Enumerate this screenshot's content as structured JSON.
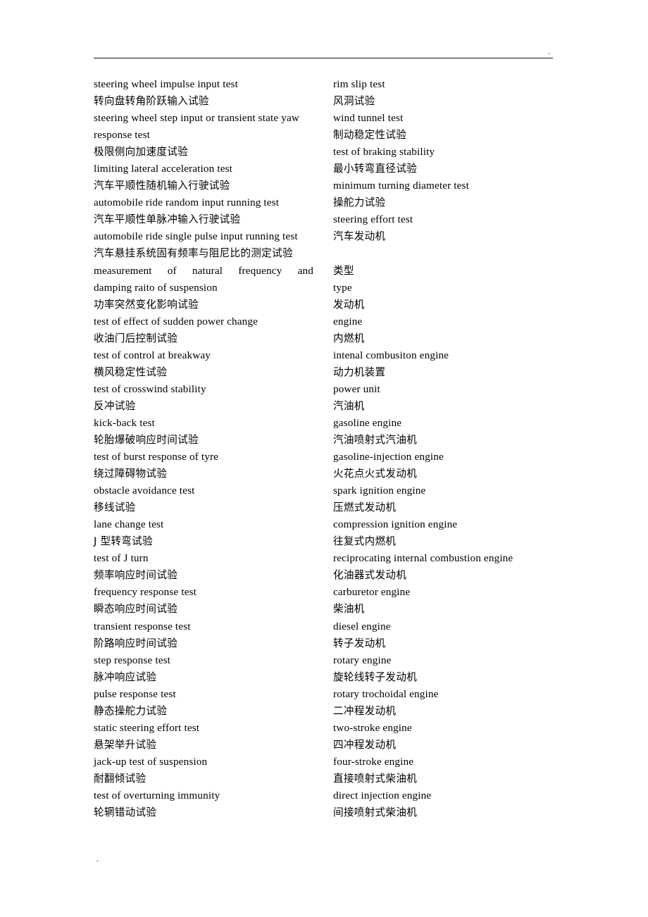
{
  "document": {
    "header_mark": ".",
    "footer_mark": ".",
    "rule": true
  },
  "glossary": {
    "left_column": [
      {
        "lang": "en",
        "text": "steering wheel impulse input test"
      },
      {
        "lang": "zh",
        "text": "转向盘转角阶跃输入试验"
      },
      {
        "lang": "en",
        "text": "steering wheel step input or transient state yaw"
      },
      {
        "lang": "en",
        "text": "response test"
      },
      {
        "lang": "zh",
        "text": "极限侧向加速度试验"
      },
      {
        "lang": "en",
        "text": "limiting lateral acceleration test"
      },
      {
        "lang": "zh",
        "text": "汽车平顺性随机输入行驶试验"
      },
      {
        "lang": "en",
        "text": "automobile ride random input running test"
      },
      {
        "lang": "zh",
        "text": "汽车平顺性单脉冲输入行驶试验"
      },
      {
        "lang": "en",
        "text": "automobile ride single pulse input running test"
      },
      {
        "lang": "zh",
        "text": "汽车悬挂系统固有频率与阻尼比的测定试验"
      },
      {
        "lang": "en",
        "justified": true,
        "words": [
          "measurement",
          "of",
          "natural",
          "frequency",
          "and"
        ],
        "text": "measurement of natural frequency and"
      },
      {
        "lang": "en",
        "text": "damping raito of suspension"
      },
      {
        "lang": "zh",
        "text": "功率突然变化影响试验"
      },
      {
        "lang": "en",
        "text": "test of effect of sudden power change"
      },
      {
        "lang": "zh",
        "text": "收油门后控制试验"
      },
      {
        "lang": "en",
        "text": "test of control at breakway"
      },
      {
        "lang": "zh",
        "text": "横风稳定性试验"
      },
      {
        "lang": "en",
        "text": "test of crosswind stability"
      },
      {
        "lang": "zh",
        "text": "反冲试验"
      },
      {
        "lang": "en",
        "text": "kick-back test"
      },
      {
        "lang": "zh",
        "text": "轮胎爆破响应时间试验"
      },
      {
        "lang": "en",
        "text": "test of burst response of tyre"
      },
      {
        "lang": "zh",
        "text": "绕过障碍物试验"
      },
      {
        "lang": "en",
        "text": "obstacle avoidance test"
      },
      {
        "lang": "zh",
        "text": "移线试验"
      },
      {
        "lang": "en",
        "text": "lane change test"
      },
      {
        "lang": "zh",
        "text": "J 型转弯试验"
      },
      {
        "lang": "en",
        "text": "test of J turn"
      },
      {
        "lang": "zh",
        "text": "频率响应时间试验"
      },
      {
        "lang": "en",
        "text": "frequency response test"
      },
      {
        "lang": "zh",
        "text": "瞬态响应时间试验"
      },
      {
        "lang": "en",
        "text": "transient response test"
      },
      {
        "lang": "zh",
        "text": "阶路响应时间试验"
      },
      {
        "lang": "en",
        "text": "step response test"
      },
      {
        "lang": "zh",
        "text": "脉冲响应试验"
      },
      {
        "lang": "en",
        "text": "pulse response test"
      },
      {
        "lang": "zh",
        "text": "静态操舵力试验"
      },
      {
        "lang": "en",
        "text": "static steering effort test"
      },
      {
        "lang": "zh",
        "text": "悬架举升试验"
      },
      {
        "lang": "en",
        "text": "jack-up test of suspension"
      },
      {
        "lang": "zh",
        "text": "耐翻倾试验"
      },
      {
        "lang": "en",
        "text": "test of overturning immunity"
      },
      {
        "lang": "zh",
        "text": "轮辋错动试验"
      }
    ],
    "right_column": [
      {
        "lang": "en",
        "text": "rim slip test"
      },
      {
        "lang": "zh",
        "text": "风洞试验"
      },
      {
        "lang": "en",
        "text": "wind tunnel test"
      },
      {
        "lang": "zh",
        "text": "制动稳定性试验"
      },
      {
        "lang": "en",
        "text": "test of braking stability"
      },
      {
        "lang": "zh",
        "text": "最小转弯直径试验"
      },
      {
        "lang": "en",
        "text": "minimum turning diameter test"
      },
      {
        "lang": "zh",
        "text": "操舵力试验"
      },
      {
        "lang": "en",
        "text": "steering effort test"
      },
      {
        "lang": "zh",
        "text": "汽车发动机"
      },
      {
        "lang": "blank",
        "text": ""
      },
      {
        "lang": "zh",
        "text": "类型"
      },
      {
        "lang": "en",
        "text": "type"
      },
      {
        "lang": "zh",
        "text": "发动机"
      },
      {
        "lang": "en",
        "text": "engine"
      },
      {
        "lang": "zh",
        "text": "内燃机"
      },
      {
        "lang": "en",
        "text": "intenal combusiton engine"
      },
      {
        "lang": "zh",
        "text": "动力机装置"
      },
      {
        "lang": "en",
        "text": "power unit"
      },
      {
        "lang": "zh",
        "text": "汽油机"
      },
      {
        "lang": "en",
        "text": "gasoline engine"
      },
      {
        "lang": "zh",
        "text": "汽油喷射式汽油机"
      },
      {
        "lang": "en",
        "text": "gasoline-injection engine"
      },
      {
        "lang": "zh",
        "text": "火花点火式发动机"
      },
      {
        "lang": "en",
        "text": "spark ignition engine"
      },
      {
        "lang": "zh",
        "text": "压燃式发动机"
      },
      {
        "lang": "en",
        "text": "compression ignition engine"
      },
      {
        "lang": "zh",
        "text": "往复式内燃机"
      },
      {
        "lang": "en",
        "text": "reciprocating internal combustion engine"
      },
      {
        "lang": "zh",
        "text": "化油器式发动机"
      },
      {
        "lang": "en",
        "text": "carburetor engine"
      },
      {
        "lang": "zh",
        "text": "柴油机"
      },
      {
        "lang": "en",
        "text": "diesel engine"
      },
      {
        "lang": "zh",
        "text": "转子发动机"
      },
      {
        "lang": "en",
        "text": "rotary engine"
      },
      {
        "lang": "zh",
        "text": "旋轮线转子发动机"
      },
      {
        "lang": "en",
        "text": "rotary trochoidal engine"
      },
      {
        "lang": "zh",
        "text": "二冲程发动机"
      },
      {
        "lang": "en",
        "text": "two-stroke engine"
      },
      {
        "lang": "zh",
        "text": "四冲程发动机"
      },
      {
        "lang": "en",
        "text": "four-stroke engine"
      },
      {
        "lang": "zh",
        "text": "直接喷射式柴油机"
      },
      {
        "lang": "en",
        "text": "direct injection engine"
      },
      {
        "lang": "zh",
        "text": "间接喷射式柴油机"
      }
    ]
  }
}
